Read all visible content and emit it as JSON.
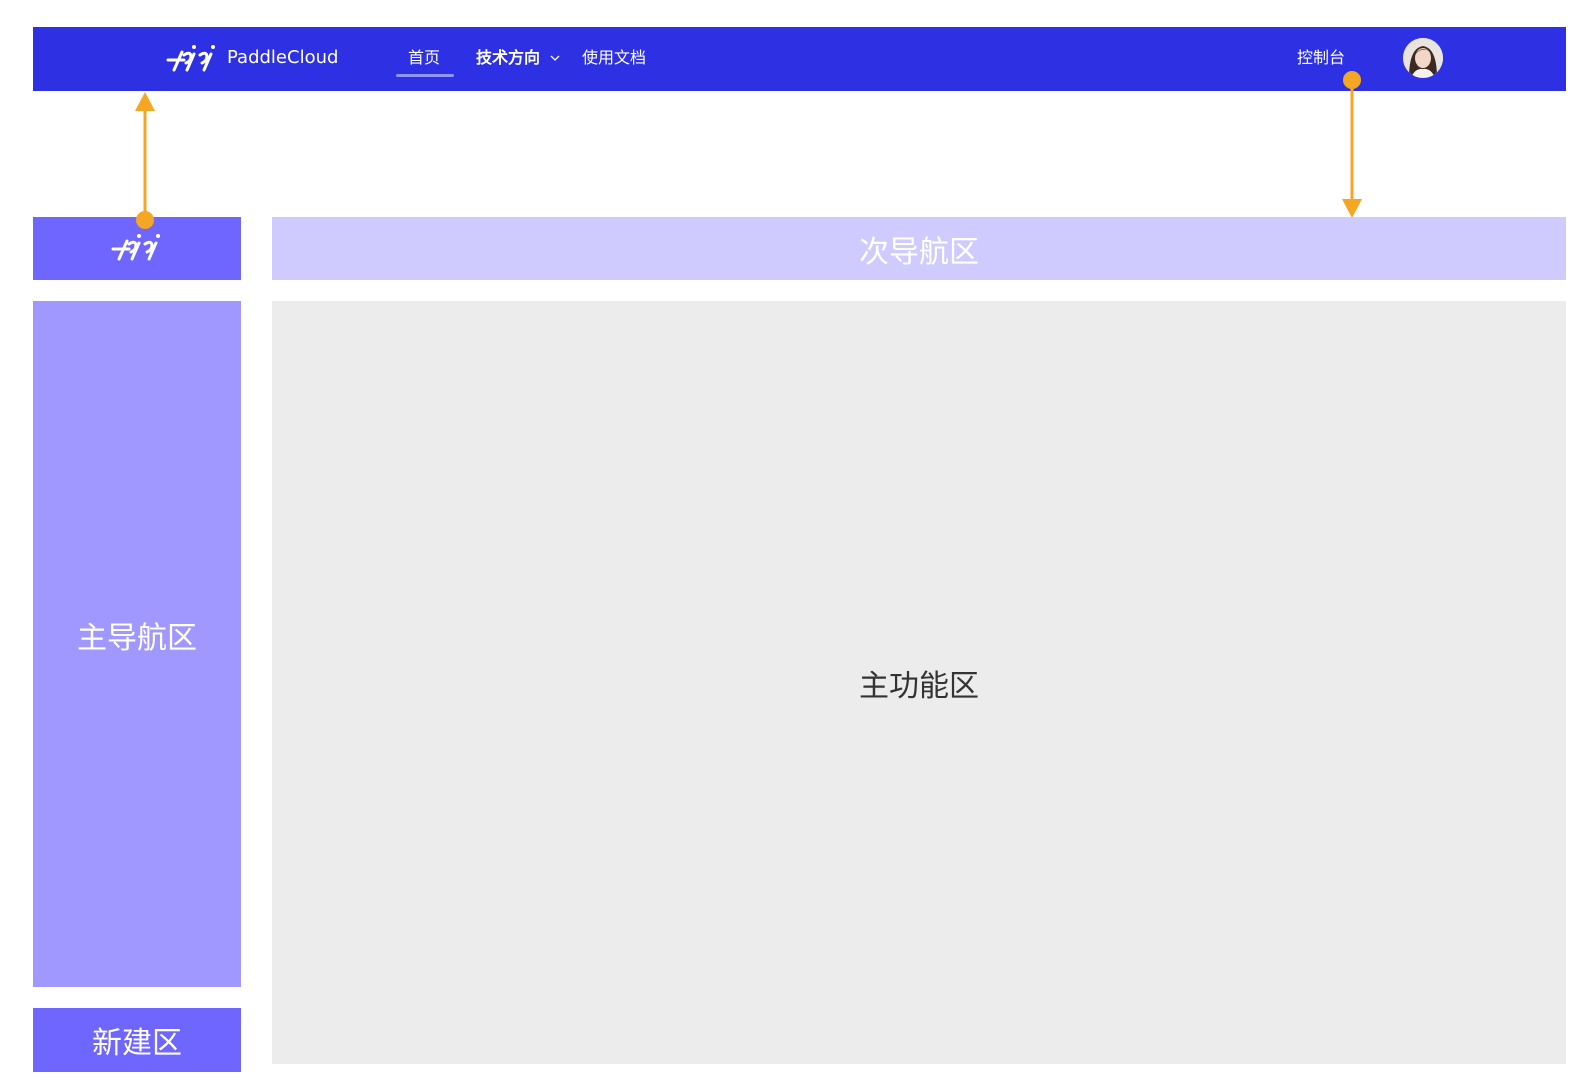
{
  "topbar": {
    "brand": "PaddleCloud",
    "nav": {
      "home": "首页",
      "tech": "技术方向",
      "docs": "使用文档"
    },
    "console": "控制台"
  },
  "regions": {
    "subnav": "次导航区",
    "mainnav": "主导航区",
    "create": "新建区",
    "main": "主功能区"
  },
  "colors": {
    "topbar": "#2d31e3",
    "logo_region": "#6f66ff",
    "subnav_region": "#cfcbff",
    "mainnav_region": "#a198ff",
    "create_region": "#6f66ff",
    "main_region": "#ececec",
    "annotation": "#f5a623"
  },
  "icons": {
    "logo": "paddle-logo-icon",
    "chevron": "chevron-down-icon",
    "avatar": "avatar"
  }
}
